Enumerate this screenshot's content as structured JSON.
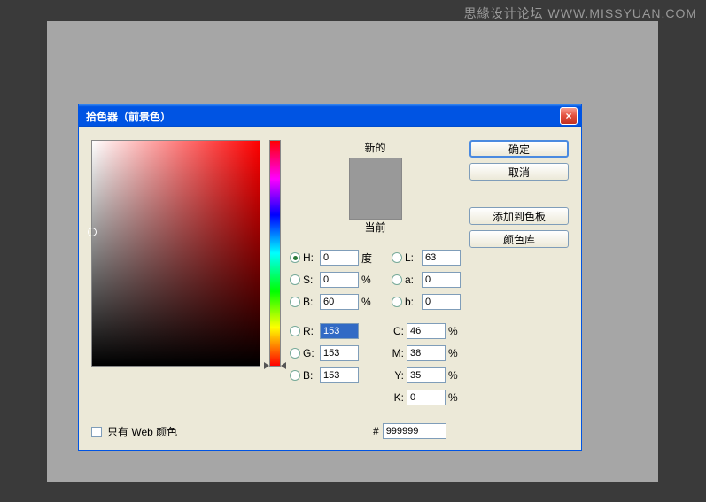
{
  "watermark": "思緣设计论坛 WWW.MISSYUAN.COM",
  "dialog": {
    "title": "拾色器（前景色）",
    "close": "×"
  },
  "swatch": {
    "new_label": "新的",
    "current_label": "当前"
  },
  "buttons": {
    "ok": "确定",
    "cancel": "取消",
    "add_swatch": "添加到色板",
    "color_lib": "颜色库"
  },
  "hsb": {
    "h_label": "H:",
    "h_val": "0",
    "h_unit": "度",
    "s_label": "S:",
    "s_val": "0",
    "s_unit": "%",
    "b_label": "B:",
    "b_val": "60",
    "b_unit": "%"
  },
  "rgb": {
    "r_label": "R:",
    "r_val": "153",
    "g_label": "G:",
    "g_val": "153",
    "b_label": "B:",
    "b_val": "153"
  },
  "lab": {
    "l_label": "L:",
    "l_val": "63",
    "a_label": "a:",
    "a_val": "0",
    "b_label": "b:",
    "b_val": "0"
  },
  "cmyk": {
    "c_label": "C:",
    "c_val": "46",
    "unit": "%",
    "m_label": "M:",
    "m_val": "38",
    "y_label": "Y:",
    "y_val": "35",
    "k_label": "K:",
    "k_val": "0"
  },
  "hex": {
    "label": "#",
    "val": "999999"
  },
  "web_only": "只有 Web 颜色"
}
